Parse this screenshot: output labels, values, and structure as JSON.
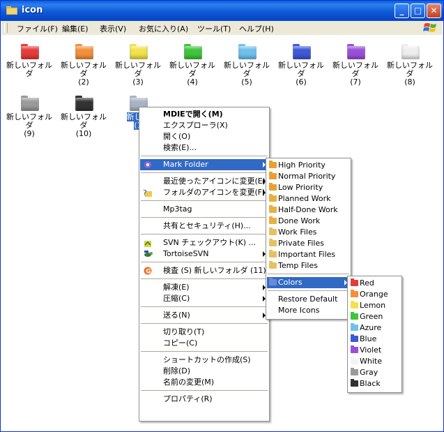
{
  "window": {
    "title": "icon",
    "buttons": {
      "minimize": "_",
      "maximize": "□",
      "close": "✕"
    }
  },
  "menubar": [
    "ファイル(F)",
    "編集(E)",
    "表示(V)",
    "お気に入り(A)",
    "ツール(T)",
    "ヘルプ(H)"
  ],
  "folders": [
    {
      "label": "新しいフォルダ",
      "sub": "",
      "color": "#e53b3b"
    },
    {
      "label": "新しいフォルダ",
      "sub": "(2)",
      "color": "#f2913a"
    },
    {
      "label": "新しいフォルダ",
      "sub": "(3)",
      "color": "#f2e24a"
    },
    {
      "label": "新しいフォルダ",
      "sub": "(4)",
      "color": "#3fc43a"
    },
    {
      "label": "新しいフォルダ",
      "sub": "(5)",
      "color": "#6fc0ee"
    },
    {
      "label": "新しいフォルダ",
      "sub": "(6)",
      "color": "#3d58d8"
    },
    {
      "label": "新しいフォルダ",
      "sub": "(7)",
      "color": "#9a4fd8"
    },
    {
      "label": "新しいフォルダ",
      "sub": "(8)",
      "color": "#eeeeee"
    },
    {
      "label": "新しいフォルダ",
      "sub": "(9)",
      "color": "#9a9a9a"
    },
    {
      "label": "新しいフォルダ",
      "sub": "(10)",
      "color": "#333333"
    },
    {
      "label": "新しい",
      "sub": "(1",
      "color": "#a8b4c4",
      "selected": true
    }
  ],
  "context_menu": [
    {
      "label": "MDIEで開く(M)",
      "bold": true
    },
    {
      "label": "エクスプローラ(X)"
    },
    {
      "label": "開く(O)"
    },
    {
      "label": "検索(E)..."
    },
    {
      "sep": true
    },
    {
      "label": "Mark Folder",
      "highlight": true,
      "submenu": true,
      "icon": "mark-folder-icon"
    },
    {
      "sep": true
    },
    {
      "label": "最近使ったアイコンに変更(E)",
      "submenu": true
    },
    {
      "label": "フォルダのアイコンを変更(F)",
      "submenu": true,
      "icon": "change-icon"
    },
    {
      "sep": true
    },
    {
      "label": "Mp3tag"
    },
    {
      "sep": true
    },
    {
      "label": "共有とセキュリティ(H)..."
    },
    {
      "sep": true
    },
    {
      "label": "SVN チェックアウト(K) ...",
      "icon": "svn-checkout-icon"
    },
    {
      "label": "TortoiseSVN",
      "submenu": true,
      "icon": "tortoise-icon"
    },
    {
      "sep": true
    },
    {
      "label": "検査 (S) 新しいフォルダ (11)",
      "icon": "scan-icon"
    },
    {
      "sep": true
    },
    {
      "label": "解凍(E)",
      "submenu": true
    },
    {
      "label": "圧縮(C)",
      "submenu": true
    },
    {
      "sep": true
    },
    {
      "label": "送る(N)",
      "submenu": true
    },
    {
      "sep": true
    },
    {
      "label": "切り取り(T)"
    },
    {
      "label": "コピー(C)"
    },
    {
      "sep": true
    },
    {
      "label": "ショートカットの作成(S)"
    },
    {
      "label": "削除(D)"
    },
    {
      "label": "名前の変更(M)"
    },
    {
      "sep": true
    },
    {
      "label": "プロパティ(R)"
    }
  ],
  "mark_folder_menu": [
    {
      "label": "High Priority",
      "color": "#e8a030"
    },
    {
      "label": "Normal Priority",
      "color": "#e8a030"
    },
    {
      "label": "Low Priority",
      "color": "#e8a030"
    },
    {
      "label": "Planned Work",
      "color": "#e8b040"
    },
    {
      "label": "Half-Done Work",
      "color": "#e8b040"
    },
    {
      "label": "Done Work",
      "color": "#e8b040"
    },
    {
      "label": "Work Files",
      "color": "#e8c060"
    },
    {
      "label": "Private Files",
      "color": "#e8c060"
    },
    {
      "label": "Important Files",
      "color": "#e8c060"
    },
    {
      "label": "Temp Files",
      "color": "#e8c060"
    },
    {
      "sep": true
    },
    {
      "label": "Colors",
      "highlight": true,
      "submenu": true,
      "color": "#6a8ad8"
    },
    {
      "sep": true
    },
    {
      "label": "Restore Default"
    },
    {
      "label": "More Icons"
    }
  ],
  "colors_menu": [
    {
      "label": "Red",
      "color": "#e53b3b"
    },
    {
      "label": "Orange",
      "color": "#f2913a"
    },
    {
      "label": "Lemon",
      "color": "#f2e24a"
    },
    {
      "label": "Green",
      "color": "#3fc43a"
    },
    {
      "label": "Azure",
      "color": "#6fc0ee"
    },
    {
      "label": "Blue",
      "color": "#3d58d8"
    },
    {
      "label": "Violet",
      "color": "#9a4fd8"
    },
    {
      "label": "White",
      "color": "#f4f4f4"
    },
    {
      "label": "Gray",
      "color": "#9a9a9a"
    },
    {
      "label": "Black",
      "color": "#333333"
    }
  ]
}
